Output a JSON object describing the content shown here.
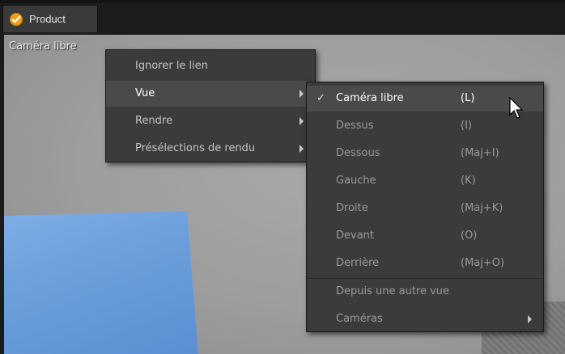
{
  "tab": {
    "label": "Product",
    "icon": "check-badge-icon"
  },
  "viewport": {
    "label": "Caméra libre"
  },
  "primary_menu": {
    "items": [
      {
        "label": "Ignorer le lien"
      },
      {
        "label": "Vue"
      },
      {
        "label": "Rendre"
      },
      {
        "label": "Présélections de rendu"
      }
    ]
  },
  "view_menu": {
    "items": [
      {
        "label": "Caméra libre",
        "shortcut": "(L)"
      },
      {
        "label": "Dessus",
        "shortcut": "(I)"
      },
      {
        "label": "Dessous",
        "shortcut": "(Maj+I)"
      },
      {
        "label": "Gauche",
        "shortcut": "(K)"
      },
      {
        "label": "Droite",
        "shortcut": "(Maj+K)"
      },
      {
        "label": "Devant",
        "shortcut": "(O)"
      },
      {
        "label": "Derrière",
        "shortcut": "(Maj+O)"
      },
      {
        "label": "Depuis une autre vue"
      },
      {
        "label": "Caméras"
      }
    ]
  },
  "colors": {
    "accent": "#f2a018",
    "plane": "#6d9fdc"
  }
}
